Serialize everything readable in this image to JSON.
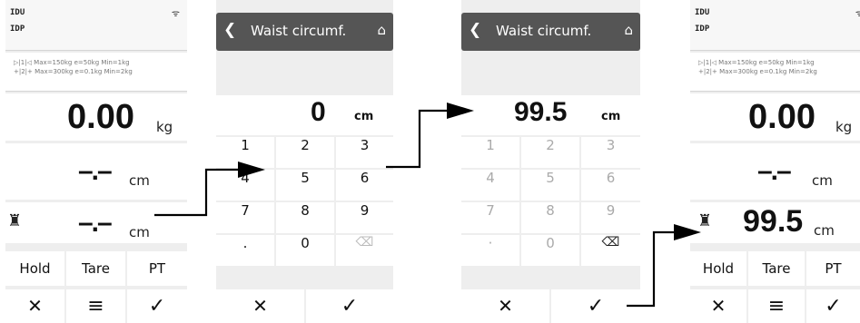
{
  "screen1": {
    "device_line1": "IDU",
    "device_line2": "IDP",
    "wifi_icon": "wifi-icon",
    "spec_line1": "▷|1|◁ Max=150kg e=50kg Min=1kg",
    "spec_line2": "+|2|+ Max=300kg e=0.1kg Min=2kg",
    "weight_value": "0.00",
    "weight_unit": "kg",
    "height_value": "–.–",
    "height_unit": "cm",
    "waist_value": "–.–",
    "waist_unit": "cm",
    "buttons": {
      "hold": "Hold",
      "tare": "Tare",
      "pt": "PT"
    },
    "bottom_icons": [
      "close-icon",
      "menu-icon",
      "check-icon"
    ]
  },
  "screen2": {
    "title": "Waist circumf.",
    "value": "0",
    "unit": "cm",
    "keys": [
      "1",
      "2",
      "3",
      "4",
      "5",
      "6",
      "7",
      "8",
      "9",
      ".",
      "0",
      "⌫"
    ],
    "bottom_icons": [
      "close-icon",
      "check-icon"
    ]
  },
  "screen3": {
    "title": "Waist circumf.",
    "value": "99.5",
    "unit": "cm",
    "keys": [
      "1",
      "2",
      "3",
      "4",
      "5",
      "6",
      "7",
      "8",
      "9",
      "·",
      "0",
      "⌫"
    ],
    "bottom_icons": [
      "close-icon",
      "check-icon"
    ]
  },
  "screen4": {
    "device_line1": "IDU",
    "device_line2": "IDP",
    "spec_line1": "▷|1|◁ Max=150kg e=50kg Min=1kg",
    "spec_line2": "+|2|+ Max=300kg e=0.1kg Min=2kg",
    "weight_value": "0.00",
    "weight_unit": "kg",
    "height_value": "–.–",
    "height_unit": "cm",
    "waist_value": "99.5",
    "waist_unit": "cm",
    "buttons": {
      "hold": "Hold",
      "tare": "Tare",
      "pt": "PT"
    },
    "bottom_icons": [
      "close-icon",
      "menu-icon",
      "check-icon"
    ]
  },
  "glyphs": {
    "wifi": "ᯤ",
    "back": "❮",
    "home": "⌂",
    "person": "♜",
    "close": "✕",
    "menu": "≡",
    "check": "✓"
  }
}
